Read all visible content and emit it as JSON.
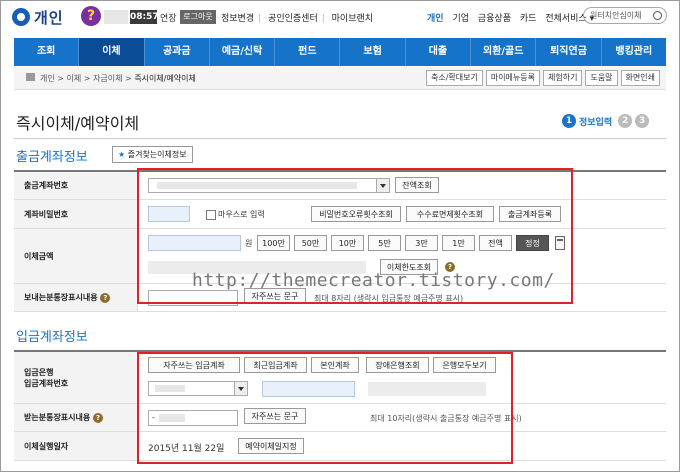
{
  "header": {
    "brand": "개인",
    "clock": "08:57",
    "extend": "연장",
    "login": "로그아웃",
    "links": [
      "정보변경",
      "공인인증센터",
      "마이브랜치"
    ],
    "right_links": [
      "개인",
      "기업",
      "금융상품",
      "카드",
      "전체서비스 ▾"
    ],
    "search_placeholder": "원터치안심이체"
  },
  "nav": [
    "조회",
    "이체",
    "공과금",
    "예금/신탁",
    "펀드",
    "보험",
    "대출",
    "외환/골드",
    "퇴직연금",
    "뱅킹관리"
  ],
  "breadcrumb": [
    "개인",
    "이체",
    "자금이체",
    "즉시이체/예약이체"
  ],
  "breadcrumb_buttons": [
    "축소/확대보기",
    "마이메뉴등록",
    "체험하기",
    "도움말",
    "화면인쇄"
  ],
  "page_title": "즉시이체/예약이체",
  "steps": {
    "current_label": "정보입력",
    "items": [
      "1",
      "2",
      "3"
    ]
  },
  "withdraw": {
    "section_title": "출금계좌정보",
    "fav_button": "즐겨찾는이체정보",
    "account_label": "출금계좌번호",
    "balance_button": "잔액조회",
    "password_label": "계좌비밀번호",
    "mouse_input": "마우스로 입력",
    "buttons": [
      "비밀번호오류횟수조회",
      "수수료면제횟수조회",
      "출금계좌등록"
    ],
    "amount_label": "이체금액",
    "amount_unit": "원",
    "amount_buttons": [
      "100만",
      "50만",
      "10만",
      "5만",
      "3만",
      "1만",
      "전액",
      "정정"
    ],
    "limit_button": "이체한도조회",
    "memo_label": "보내는분통장표시내용",
    "phrase_button": "자주쓰는 문구",
    "memo_hint": "최대 8자리 (생략시 입금통장 예금주명 표시)"
  },
  "deposit": {
    "section_title": "입금계좌정보",
    "bank_label_1": "입금은행",
    "bank_label_2": "입금계좌번호",
    "buttons": [
      "자주쓰는 입금계좌",
      "최근입금계좌",
      "본인계좌",
      "장애은행조회",
      "은행모두보기"
    ],
    "memo_label": "받는분통장표시내용",
    "memo_value": "-",
    "phrase_button": "자주쓰는 문구",
    "memo_hint": "최대 10자리(생략시 출금통장 예금주명 표시)",
    "date_label": "이체실행일자",
    "date_value": "2015년 11월 22일",
    "schedule_button": "예약이체일지정"
  },
  "watermark": "http://themecreator.tistory.com/",
  "colors": {
    "accent": "#1573c9",
    "nav_active": "#0a4d96",
    "highlight": "#e1202a"
  }
}
